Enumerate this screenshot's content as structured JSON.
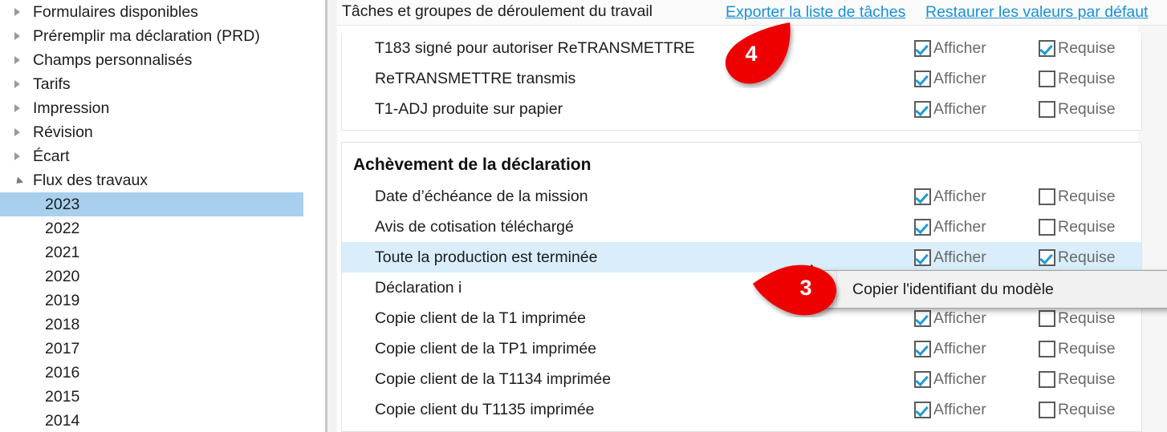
{
  "sidebar": {
    "tree_items": [
      {
        "label": "Formulaires disponibles",
        "state": "collapsed",
        "icon": "chevron-right-icon"
      },
      {
        "label": "Préremplir ma déclaration (PRD)",
        "state": "collapsed",
        "icon": "chevron-right-icon"
      },
      {
        "label": "Champs personnalisés",
        "state": "collapsed",
        "icon": "chevron-right-icon"
      },
      {
        "label": "Tarifs",
        "state": "collapsed",
        "icon": "chevron-right-icon"
      },
      {
        "label": "Impression",
        "state": "collapsed",
        "icon": "chevron-right-icon"
      },
      {
        "label": "Révision",
        "state": "collapsed",
        "icon": "chevron-right-icon"
      },
      {
        "label": "Écart",
        "state": "collapsed",
        "icon": "chevron-right-icon"
      },
      {
        "label": "Flux des travaux",
        "state": "expanded",
        "icon": "chevron-down-icon"
      }
    ],
    "years": [
      {
        "label": "2023",
        "selected": true
      },
      {
        "label": "2022",
        "selected": false
      },
      {
        "label": "2021",
        "selected": false
      },
      {
        "label": "2020",
        "selected": false
      },
      {
        "label": "2019",
        "selected": false
      },
      {
        "label": "2018",
        "selected": false
      },
      {
        "label": "2017",
        "selected": false
      },
      {
        "label": "2016",
        "selected": false
      },
      {
        "label": "2015",
        "selected": false
      },
      {
        "label": "2014",
        "selected": false
      }
    ],
    "selection_color": "#a8d0ee"
  },
  "header": {
    "title": "Tâches et groupes de déroulement du travail",
    "export_link": "Exporter la liste de tâches",
    "restore_link": "Restaurer les valeurs par défaut",
    "link_color": "#1a8fd8"
  },
  "columns": {
    "show_label": "Afficher",
    "required_label": "Requise"
  },
  "groups": [
    {
      "title": "",
      "rows": [
        {
          "label": "T183 signé pour autoriser ReTRANSMETTRE",
          "show": true,
          "required": true,
          "highlight": false
        },
        {
          "label": "ReTRANSMETTRE transmis",
          "show": true,
          "required": false,
          "highlight": false
        },
        {
          "label": "T1-ADJ produite sur papier",
          "show": true,
          "required": false,
          "highlight": false
        }
      ]
    },
    {
      "title": "Achèvement de la déclaration",
      "rows": [
        {
          "label": "Date d’échéance de la mission",
          "show": true,
          "required": false,
          "highlight": false
        },
        {
          "label": "Avis de cotisation téléchargé",
          "show": true,
          "required": false,
          "highlight": false
        },
        {
          "label": "Toute la production est terminée",
          "show": true,
          "required": true,
          "highlight": true
        },
        {
          "label": "Déclaration i",
          "show": true,
          "required": false,
          "highlight": false
        },
        {
          "label": "Copie client de la T1 imprimée",
          "show": true,
          "required": false,
          "highlight": false
        },
        {
          "label": "Copie client de la TP1 imprimée",
          "show": true,
          "required": false,
          "highlight": false
        },
        {
          "label": "Copie client de la T1134 imprimée",
          "show": true,
          "required": false,
          "highlight": false
        },
        {
          "label": "Copie client du T1135 imprimée",
          "show": true,
          "required": false,
          "highlight": false
        }
      ]
    }
  ],
  "context_menu": {
    "item_label": "Copier l'identifiant du modèle",
    "icon": "copy-document-icon"
  },
  "markers": [
    {
      "number": "3",
      "color": "#ee0000",
      "direction": "left"
    },
    {
      "number": "4",
      "color": "#ee0000",
      "direction": "up-right"
    }
  ],
  "row_highlight_color": "#d9eefa",
  "checkbox_check_color": "#1e9ad6"
}
